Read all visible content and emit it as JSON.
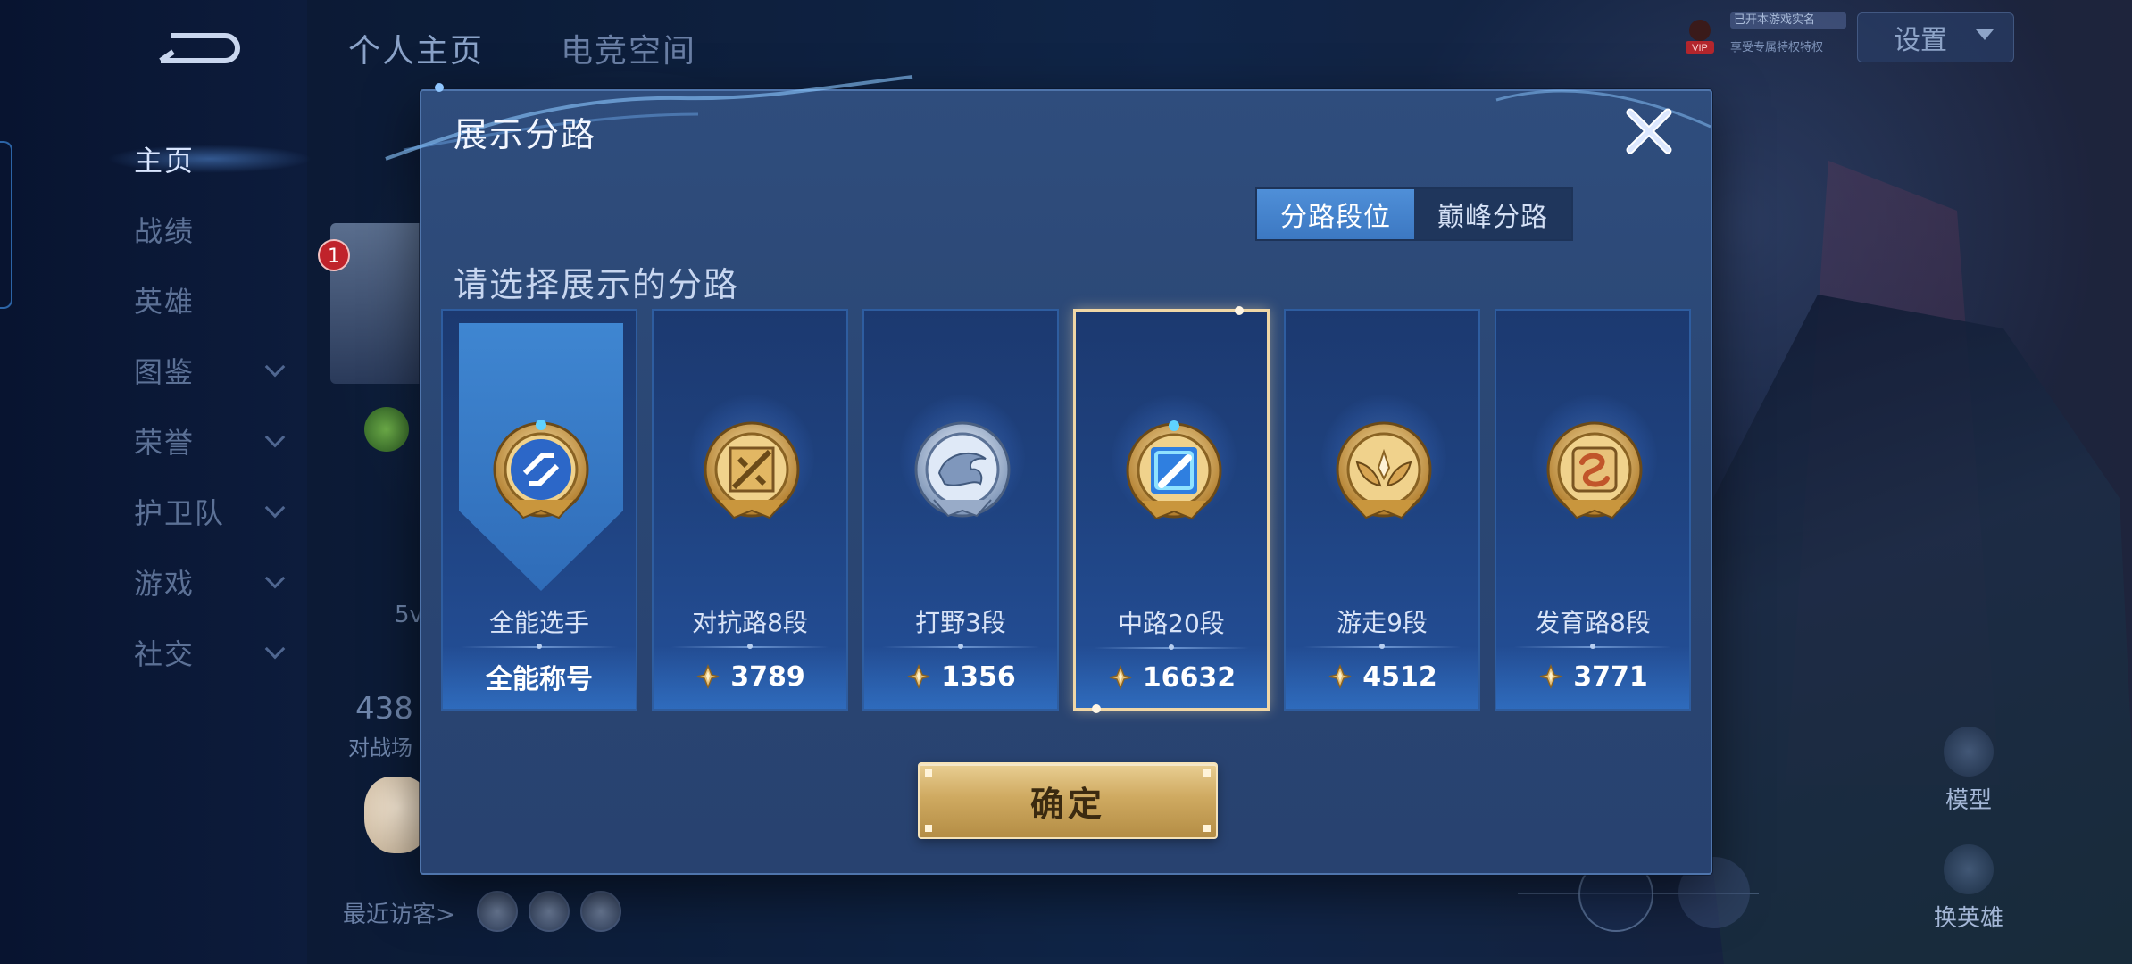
{
  "sidebar": {
    "items": [
      {
        "label": "主页",
        "active": true,
        "has_chevron": false
      },
      {
        "label": "战绩",
        "active": false,
        "has_chevron": false
      },
      {
        "label": "英雄",
        "active": false,
        "has_chevron": false
      },
      {
        "label": "图鉴",
        "active": false,
        "has_chevron": true
      },
      {
        "label": "荣誉",
        "active": false,
        "has_chevron": true
      },
      {
        "label": "护卫队",
        "active": false,
        "has_chevron": true
      },
      {
        "label": "游戏",
        "active": false,
        "has_chevron": true
      },
      {
        "label": "社交",
        "active": false,
        "has_chevron": true
      }
    ]
  },
  "header": {
    "tabs": [
      "个人主页",
      "电竞空间"
    ],
    "settings_label": "设置",
    "vip_label": "VIP",
    "vip_note": "已开本游戏实名",
    "vip_note2": "享受专属特权特权"
  },
  "profile": {
    "badge_count": "1",
    "fragment_5v": "5v",
    "fragment_num": "438",
    "fragment_label": "对战场",
    "visitors_label": "最近访客>"
  },
  "right_panel": {
    "model_label": "模型",
    "swap_label": "换英雄"
  },
  "modal": {
    "title": "展示分路",
    "subtitle": "请选择展示的分路",
    "segments": [
      {
        "label": "分路段位",
        "active": true
      },
      {
        "label": "巅峰分路",
        "active": false
      }
    ],
    "confirm_label": "确定",
    "cards": [
      {
        "name": "全能选手",
        "value": "全能称号",
        "show_points_icon": false,
        "selected": false,
        "ribbon": true,
        "emblem": "all-round-emblem"
      },
      {
        "name": "对抗路8段",
        "value": "3789",
        "show_points_icon": true,
        "selected": false,
        "ribbon": false,
        "emblem": "clash-lane-emblem"
      },
      {
        "name": "打野3段",
        "value": "1356",
        "show_points_icon": true,
        "selected": false,
        "ribbon": false,
        "emblem": "jungle-emblem"
      },
      {
        "name": "中路20段",
        "value": "16632",
        "show_points_icon": true,
        "selected": true,
        "ribbon": false,
        "emblem": "mid-lane-emblem"
      },
      {
        "name": "游走9段",
        "value": "4512",
        "show_points_icon": true,
        "selected": false,
        "ribbon": false,
        "emblem": "roam-emblem"
      },
      {
        "name": "发育路8段",
        "value": "3771",
        "show_points_icon": true,
        "selected": false,
        "ribbon": false,
        "emblem": "farm-lane-emblem"
      }
    ]
  },
  "colors": {
    "accent_blue": "#3c78c2",
    "gold": "#cfaa61",
    "modal_bg": "#2a4673",
    "selected_border": "#f0d7a6"
  }
}
